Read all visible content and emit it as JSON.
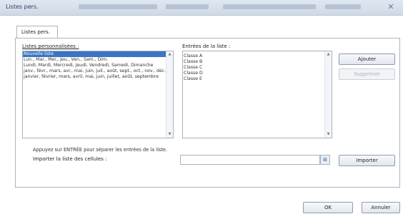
{
  "window": {
    "title": "Listes pers.",
    "close_glyph": "✕"
  },
  "tabs": [
    {
      "label": "Listes pers."
    }
  ],
  "custom_lists": {
    "label": "Listes personnalisées :",
    "items": [
      "Nouvelle liste",
      "Lun., Mar., Mer., Jeu., Ven., Sam., Dim.",
      "Lundi, Mardi, Mercredi, Jeudi, Vendredi, Samedi, Dimanche",
      "janv., févr., mars, avr., mai, juin, juil., août, sept., oct., nov., déc.",
      "janvier, février, mars, avril, mai, juin, juillet, août, septembre"
    ],
    "selected_index": 0
  },
  "list_entries": {
    "label": "Entrées de la liste :",
    "items": [
      "Classe A",
      "Classe B",
      "Classe C",
      "Classe D",
      "Classe E"
    ]
  },
  "buttons": {
    "add": "Ajouter",
    "delete": "Supprimer",
    "import": "Importer",
    "ok": "OK",
    "cancel": "Annuler"
  },
  "hint": "Appuyez sur ENTRÉE pour séparer les entrées de la liste.",
  "import_field": {
    "label": "Importer la liste des cellules :",
    "value": ""
  },
  "icons": {
    "scroll_up": "▲",
    "scroll_down": "▼",
    "range_select": "⊞"
  }
}
